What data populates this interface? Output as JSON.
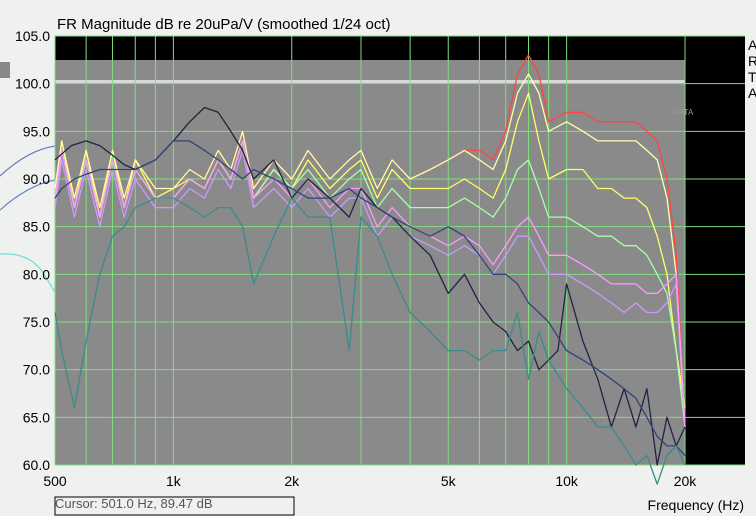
{
  "chart_data": {
    "type": "line",
    "title": "FR Magnitude dB re 20uPa/V (smoothed 1/24 oct)",
    "xlabel": "Frequency (Hz)",
    "ylabel": "",
    "x_scale": "log",
    "xlim": [
      500,
      20000
    ],
    "ylim": [
      60,
      105
    ],
    "grid": true,
    "y_ticks": [
      "105.0",
      "100.0",
      "95.0",
      "90.0",
      "85.0",
      "80.0",
      "75.0",
      "70.0",
      "65.0",
      "60.0"
    ],
    "x_ticks": [
      {
        "value": 500,
        "label": "500"
      },
      {
        "value": 1000,
        "label": "1k"
      },
      {
        "value": 2000,
        "label": "2k"
      },
      {
        "value": 5000,
        "label": "5k"
      },
      {
        "value": 10000,
        "label": "10k"
      },
      {
        "value": 20000,
        "label": "20k"
      }
    ],
    "series": [
      {
        "color": "#ff4444",
        "x": [
          500,
          520,
          560,
          600,
          650,
          700,
          750,
          800,
          900,
          1000,
          1100,
          1200,
          1300,
          1400,
          1500,
          1600,
          1800,
          2000,
          2200,
          2500,
          2800,
          3000,
          3300,
          3600,
          4000,
          4500,
          5000,
          5500,
          6000,
          6500,
          7000,
          7500,
          8000,
          8500,
          9000,
          10000,
          11000,
          12000,
          13000,
          14000,
          15000,
          16000,
          17000,
          18000,
          19000,
          20000
        ],
        "y": [
          89,
          94,
          88,
          93,
          87,
          93,
          88,
          92,
          89,
          89,
          91,
          90,
          93,
          91,
          95,
          89,
          92,
          90,
          93,
          90,
          92,
          93,
          89,
          92,
          90,
          91,
          92,
          93,
          93,
          92,
          95,
          101,
          103,
          101,
          96,
          97,
          97,
          96,
          96,
          96,
          96,
          95,
          94,
          90,
          82,
          64
        ]
      },
      {
        "color": "#ffff66",
        "x": [
          500,
          520,
          560,
          600,
          650,
          700,
          750,
          800,
          900,
          1000,
          1100,
          1200,
          1300,
          1400,
          1500,
          1600,
          1800,
          2000,
          2200,
          2500,
          2800,
          3000,
          3300,
          3600,
          4000,
          4500,
          5000,
          5500,
          6000,
          6500,
          7000,
          7500,
          8000,
          8500,
          9000,
          10000,
          11000,
          12000,
          13000,
          14000,
          15000,
          16000,
          17000,
          18000,
          19000,
          20000
        ],
        "y": [
          88,
          94,
          87,
          93,
          86,
          93,
          87,
          92,
          88,
          89,
          90,
          89,
          92,
          90,
          94,
          88,
          91,
          89,
          92,
          89,
          91,
          92,
          88,
          91,
          89,
          89,
          89,
          90,
          89,
          88,
          91,
          96,
          99,
          94,
          90,
          91,
          91,
          89,
          89,
          88,
          88,
          87,
          84,
          80,
          72,
          66
        ]
      },
      {
        "color": "#ffffaa",
        "x": [
          500,
          520,
          560,
          600,
          650,
          700,
          750,
          800,
          900,
          1000,
          1100,
          1200,
          1300,
          1400,
          1500,
          1600,
          1800,
          2000,
          2200,
          2500,
          2800,
          3000,
          3300,
          3600,
          4000,
          4500,
          5000,
          5500,
          6000,
          6500,
          7000,
          7500,
          8000,
          8500,
          9000,
          10000,
          11000,
          12000,
          13000,
          14000,
          15000,
          16000,
          17000,
          18000,
          19000,
          20000
        ],
        "y": [
          89,
          94,
          88,
          93,
          87,
          93,
          88,
          92,
          89,
          89,
          91,
          90,
          93,
          91,
          95,
          89,
          92,
          90,
          93,
          90,
          92,
          93,
          89,
          92,
          90,
          91,
          92,
          93,
          92,
          91,
          94,
          99,
          101,
          99,
          95,
          96,
          95,
          94,
          94,
          94,
          94,
          93,
          92,
          88,
          80,
          64
        ]
      },
      {
        "color": "#aaffaa",
        "x": [
          500,
          520,
          560,
          600,
          650,
          700,
          750,
          800,
          900,
          1000,
          1100,
          1200,
          1300,
          1400,
          1500,
          1600,
          1800,
          2000,
          2200,
          2500,
          2800,
          3000,
          3300,
          3600,
          4000,
          4500,
          5000,
          5500,
          6000,
          6500,
          7000,
          7500,
          8000,
          8500,
          9000,
          10000,
          11000,
          12000,
          13000,
          14000,
          15000,
          16000,
          17000,
          18000,
          19000,
          20000
        ],
        "y": [
          88,
          93,
          87,
          92,
          86,
          92,
          87,
          91,
          88,
          88,
          90,
          89,
          92,
          90,
          94,
          88,
          91,
          89,
          91,
          88,
          90,
          91,
          87,
          89,
          87,
          87,
          87,
          88,
          87,
          86,
          88,
          91,
          92,
          89,
          86,
          86,
          85,
          84,
          84,
          83,
          83,
          82,
          80,
          78,
          72,
          64
        ]
      },
      {
        "color": "#cc99ff",
        "x": [
          500,
          520,
          560,
          600,
          650,
          700,
          750,
          800,
          900,
          1000,
          1100,
          1200,
          1300,
          1400,
          1500,
          1600,
          1800,
          2000,
          2200,
          2500,
          2800,
          3000,
          3300,
          3600,
          4000,
          4500,
          5000,
          5500,
          6000,
          6500,
          7000,
          7500,
          8000,
          8500,
          9000,
          10000,
          11000,
          12000,
          13000,
          14000,
          15000,
          16000,
          17000,
          18000,
          19000,
          20000
        ],
        "y": [
          87,
          92,
          86,
          91,
          85,
          91,
          86,
          90,
          87,
          87,
          89,
          88,
          91,
          89,
          93,
          87,
          89,
          87,
          89,
          86,
          88,
          88,
          84,
          86,
          84,
          83,
          82,
          83,
          82,
          80,
          82,
          84,
          84,
          82,
          80,
          80,
          79,
          78,
          77,
          76,
          77,
          76,
          76,
          77,
          79,
          64
        ]
      },
      {
        "color": "#ff99ff",
        "x": [
          500,
          520,
          560,
          600,
          650,
          700,
          750,
          800,
          900,
          1000,
          1100,
          1200,
          1300,
          1400,
          1500,
          1600,
          1800,
          2000,
          2200,
          2500,
          2800,
          3000,
          3300,
          3600,
          4000,
          4500,
          5000,
          5500,
          6000,
          6500,
          7000,
          7500,
          8000,
          8500,
          9000,
          10000,
          11000,
          12000,
          13000,
          14000,
          15000,
          16000,
          17000,
          18000,
          19000,
          20000
        ],
        "y": [
          88,
          93,
          87,
          92,
          86,
          92,
          87,
          91,
          88,
          88,
          90,
          89,
          92,
          90,
          94,
          88,
          90,
          88,
          90,
          87,
          89,
          89,
          85,
          87,
          85,
          84,
          83,
          84,
          83,
          81,
          83,
          85,
          86,
          84,
          82,
          82,
          81,
          80,
          79,
          79,
          79,
          78,
          78,
          79,
          80,
          64
        ]
      },
      {
        "color": "#222244",
        "x": [
          500,
          550,
          600,
          650,
          700,
          750,
          800,
          900,
          1000,
          1100,
          1200,
          1300,
          1400,
          1500,
          1600,
          1800,
          2000,
          2200,
          2500,
          2800,
          3000,
          3300,
          3600,
          4000,
          4500,
          5000,
          5500,
          6000,
          6500,
          7000,
          7500,
          8000,
          8500,
          9000,
          9500,
          10000,
          11000,
          12000,
          13000,
          14000,
          15000,
          16000,
          17000,
          18000,
          19000,
          20000
        ],
        "y": [
          92,
          93.5,
          94,
          93.5,
          92.5,
          91.5,
          91,
          92,
          94,
          96,
          97.5,
          97,
          95,
          93,
          90,
          92,
          88,
          90,
          88,
          86,
          89,
          87,
          86,
          84,
          82,
          78,
          80,
          77,
          75,
          74,
          72,
          73,
          70,
          71,
          72,
          79,
          73,
          69,
          64,
          68,
          64,
          68,
          60,
          65,
          62,
          64
        ]
      },
      {
        "color": "#334477",
        "x": [
          500,
          520,
          560,
          600,
          650,
          700,
          750,
          800,
          900,
          1000,
          1100,
          1200,
          1300,
          1400,
          1500,
          1600,
          1800,
          2000,
          2200,
          2500,
          2800,
          3000,
          3300,
          3600,
          4000,
          4500,
          5000,
          5500,
          6000,
          6500,
          7000,
          7500,
          8000,
          8500,
          9000,
          10000,
          11000,
          12000,
          13000,
          14000,
          15000,
          16000,
          17000,
          18000,
          19000,
          20000
        ],
        "y": [
          88,
          89,
          90,
          90.5,
          91,
          91,
          91,
          91,
          92,
          94,
          94,
          93,
          92,
          91,
          90,
          91,
          90,
          89,
          88,
          88,
          89,
          88,
          87,
          86,
          85,
          84,
          85,
          84,
          82,
          80,
          80,
          79,
          77,
          76,
          75,
          72,
          71,
          70,
          69,
          68,
          67,
          65,
          63,
          62,
          62,
          61
        ]
      },
      {
        "color": "#3a8c8c",
        "x": [
          500,
          520,
          560,
          600,
          650,
          700,
          750,
          800,
          900,
          1000,
          1100,
          1200,
          1300,
          1400,
          1500,
          1600,
          1800,
          2000,
          2200,
          2500,
          2800,
          3000,
          3300,
          3600,
          4000,
          4500,
          5000,
          5500,
          6000,
          6500,
          7000,
          7500,
          8000,
          8500,
          9000,
          10000,
          11000,
          12000,
          13000,
          14000,
          15000,
          16000,
          17000,
          18000,
          19000,
          20000
        ],
        "y": [
          76,
          72,
          66,
          73,
          80,
          84,
          85,
          87,
          88,
          88,
          87,
          86,
          87,
          87,
          85,
          79,
          84,
          88,
          86,
          86,
          72,
          86,
          84,
          80,
          76,
          74,
          72,
          72,
          71,
          72,
          72,
          76,
          69,
          74,
          71,
          68,
          66,
          64,
          64,
          62,
          60,
          61,
          58,
          61,
          62,
          60
        ]
      }
    ]
  },
  "cursor": {
    "text": "Cursor: 501.0 Hz, 89.47 dB"
  },
  "watermark": "ARTA",
  "legend": [
    "A",
    "R",
    "T",
    "A"
  ]
}
